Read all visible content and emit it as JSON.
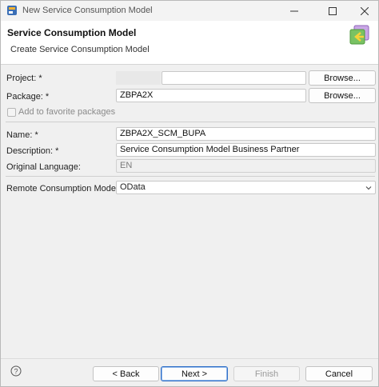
{
  "window": {
    "title": "New Service Consumption Model",
    "icons": {
      "app": "eclipse-app-icon",
      "minimize": "minimize-icon",
      "maximize": "maximize-icon",
      "close": "close-icon"
    }
  },
  "banner": {
    "title": "Service Consumption Model",
    "subtitle": "Create Service Consumption Model",
    "icon": "wizard-banner-icon"
  },
  "form": {
    "project": {
      "label": "Project: *",
      "value": "",
      "browse": "Browse..."
    },
    "package": {
      "label": "Package: *",
      "value": "ZBPA2X",
      "browse": "Browse..."
    },
    "favorites": {
      "label": "Add to favorite packages",
      "checked": false
    },
    "name": {
      "label": "Name: *",
      "value": "ZBPA2X_SCM_BUPA"
    },
    "description": {
      "label": "Description: *",
      "value": "Service Consumption Model Business Partner"
    },
    "original_language": {
      "label": "Original Language:",
      "value": "EN"
    },
    "remote_mode": {
      "label": "Remote Consumption Mode: *",
      "value": "OData"
    }
  },
  "footer": {
    "help_icon": "help-icon",
    "back": "< Back",
    "next": "Next >",
    "finish": "Finish",
    "cancel": "Cancel"
  },
  "colors": {
    "accent": "#2f6fc7",
    "banner_bg": "#ffffff",
    "dialog_bg": "#f0f0f0"
  }
}
